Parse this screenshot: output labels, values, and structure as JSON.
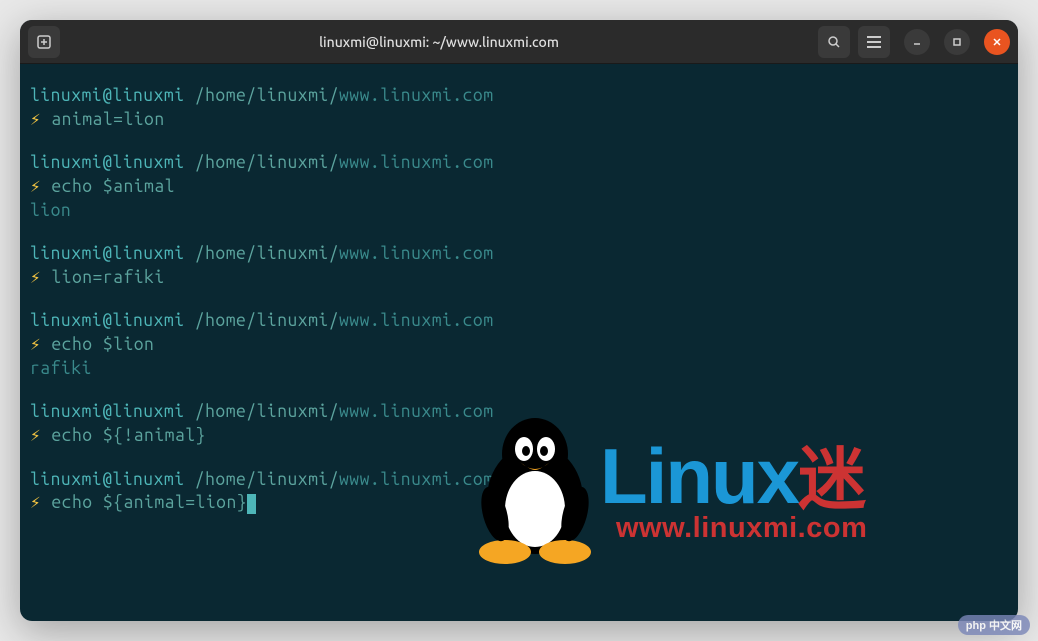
{
  "window": {
    "title": "linuxmi@linuxmi: ~/www.linuxmi.com"
  },
  "prompt": {
    "user_host": "linuxmi@linuxmi",
    "path_prefix": " /home/linuxmi/",
    "path_url": "www.linuxmi.com",
    "bolt": "⚡"
  },
  "blocks": [
    {
      "cmd": " animal=lion",
      "output": null
    },
    {
      "cmd": " echo $animal",
      "output": "lion"
    },
    {
      "cmd": " lion=rafiki",
      "output": null
    },
    {
      "cmd": " echo $lion",
      "output": "rafiki"
    },
    {
      "cmd": " echo ${!animal}",
      "output": null
    },
    {
      "cmd": " echo ${animal=lion}",
      "output": null,
      "cursor": true
    }
  ],
  "watermark": {
    "brand_en": "Linux",
    "brand_cn": "迷",
    "url": "www.linuxmi.com"
  },
  "badge": {
    "text": "php 中文网"
  }
}
